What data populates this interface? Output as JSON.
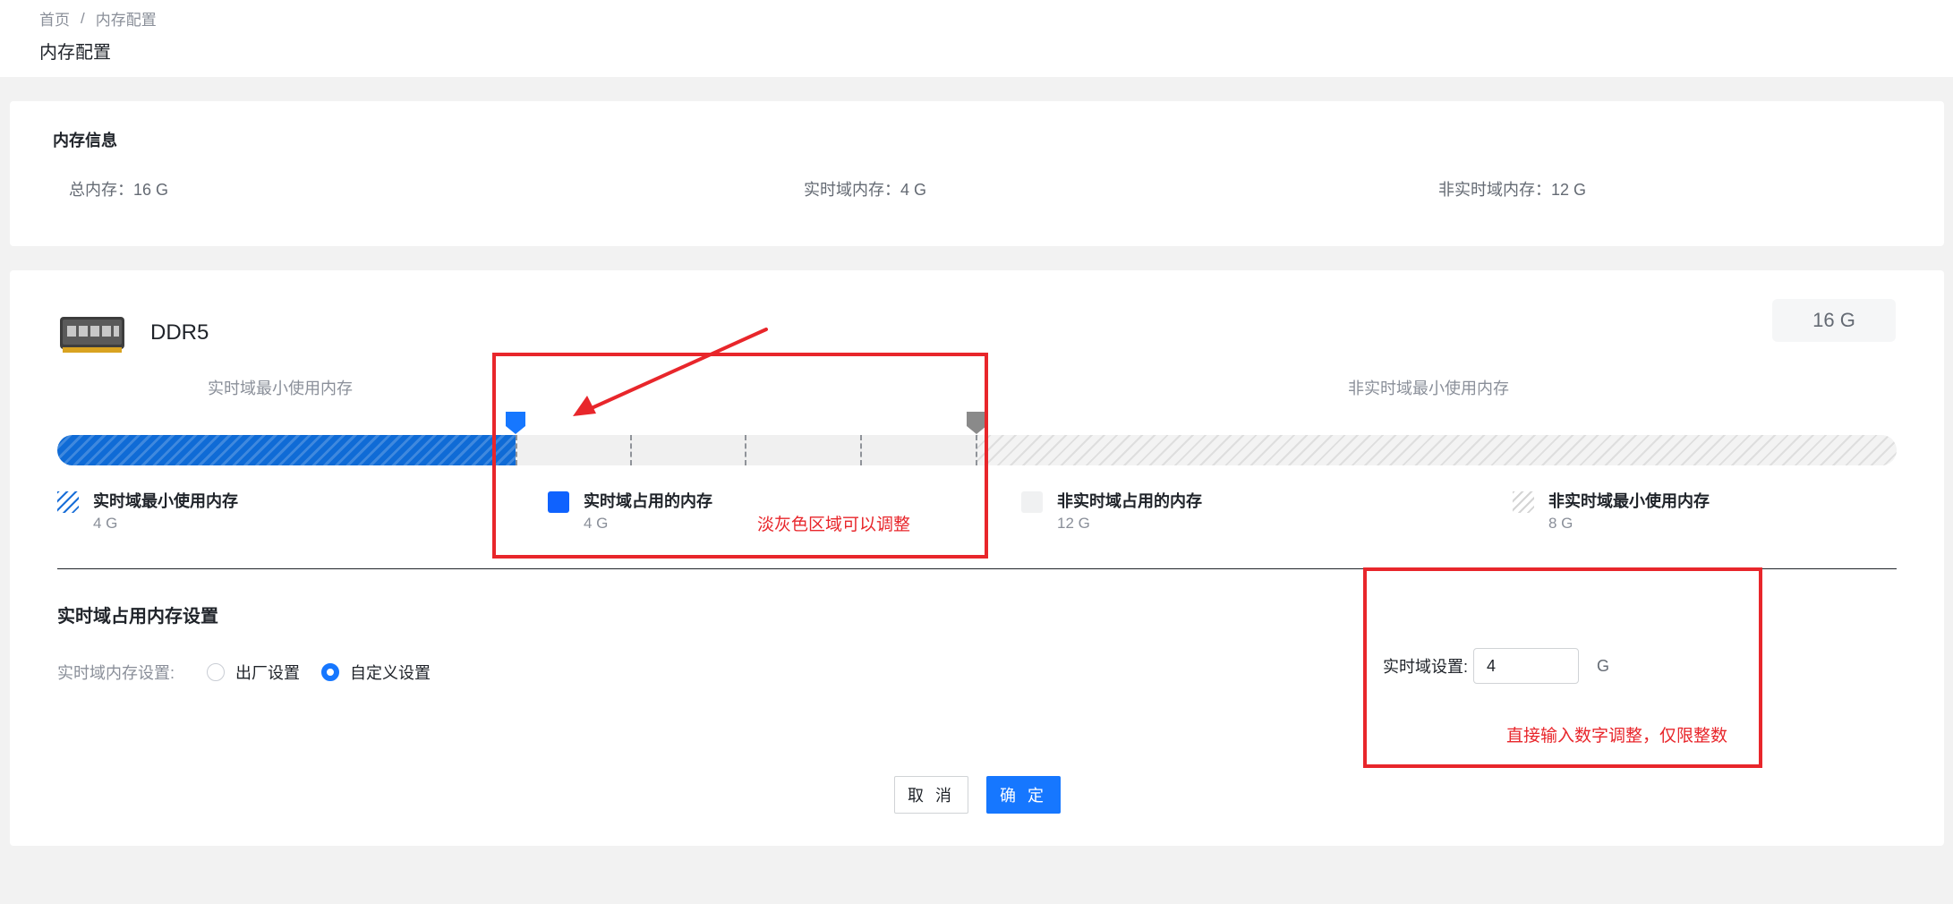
{
  "breadcrumb": {
    "home": "首页",
    "separator": "/",
    "current": "内存配置"
  },
  "page_title": "内存配置",
  "info": {
    "title": "内存信息",
    "total": "总内存：16 G",
    "realtime": "实时域内存：4 G",
    "non_realtime": "非实时域内存：12 G"
  },
  "memory": {
    "type": "DDR5",
    "total_badge": "16 G",
    "icon": "ram-module-icon",
    "bar_left_label": "实时域最小使用内存",
    "bar_right_label": "非实时域最小使用内存",
    "bar_segments_gb": {
      "realtime_min": 4,
      "adjustable": 4,
      "non_realtime_min": 8,
      "total": 16
    },
    "legend": [
      {
        "name": "实时域最小使用内存",
        "value": "4 G"
      },
      {
        "name": "实时域占用的内存",
        "value": "4 G"
      },
      {
        "name": "非实时域占用的内存",
        "value": "12 G"
      },
      {
        "name": "非实时域最小使用内存",
        "value": "8 G"
      }
    ]
  },
  "settings": {
    "section_title": "实时域占用内存设置",
    "radio_label": "实时域内存设置:",
    "options": [
      "出厂设置",
      "自定义设置"
    ],
    "selected": "自定义设置",
    "rt_label": "实时域设置:",
    "rt_value": "4",
    "rt_unit": "G"
  },
  "buttons": {
    "cancel": "取 消",
    "ok": "确 定"
  },
  "annotations": {
    "bar_note": "淡灰色区域可以调整",
    "input_note": "直接输入数字调整，仅限整数",
    "color": "#e8262b"
  },
  "colors": {
    "primary": "#1677ff",
    "realtime_bar": "#0f6bd6",
    "background": "#f2f2f2"
  }
}
